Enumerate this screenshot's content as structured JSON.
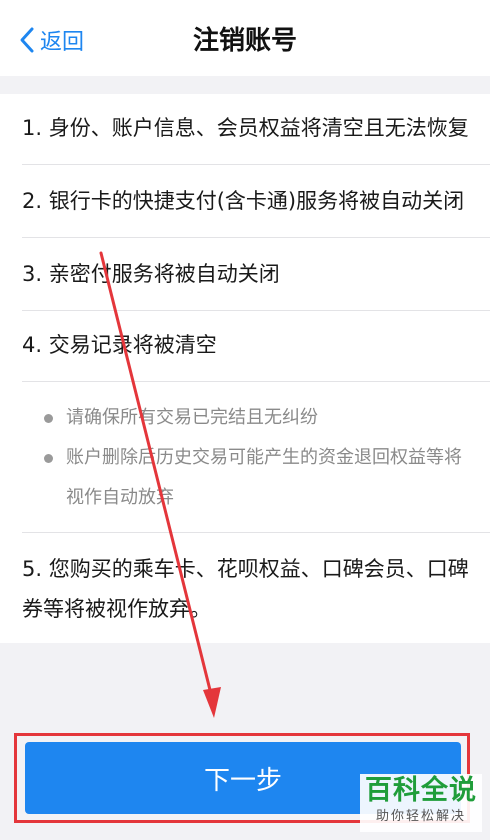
{
  "nav": {
    "back_label": "返回",
    "title": "注销账号"
  },
  "items": [
    "1. 身份、账户信息、会员权益将清空且无法恢复",
    "2. 银行卡的快捷支付(含卡通)服务将被自动关闭",
    "3. 亲密付服务将被自动关闭",
    "4. 交易记录将被清空"
  ],
  "notes": [
    "请确保所有交易已完结且无纠纷",
    "账户删除后历史交易可能产生的资金退回权益等将视作自动放弃"
  ],
  "item5": "5. 您购买的乘车卡、花呗权益、口碑会员、口碑券等将被视作放弃。",
  "button": {
    "label": "下一步",
    "color": "#1e86f0"
  },
  "annotation": {
    "highlight_color": "#e4363b"
  },
  "watermark": {
    "main": "百科全说",
    "sub": "助你轻松解决"
  },
  "icons": {
    "back": "chevron-left-icon"
  }
}
